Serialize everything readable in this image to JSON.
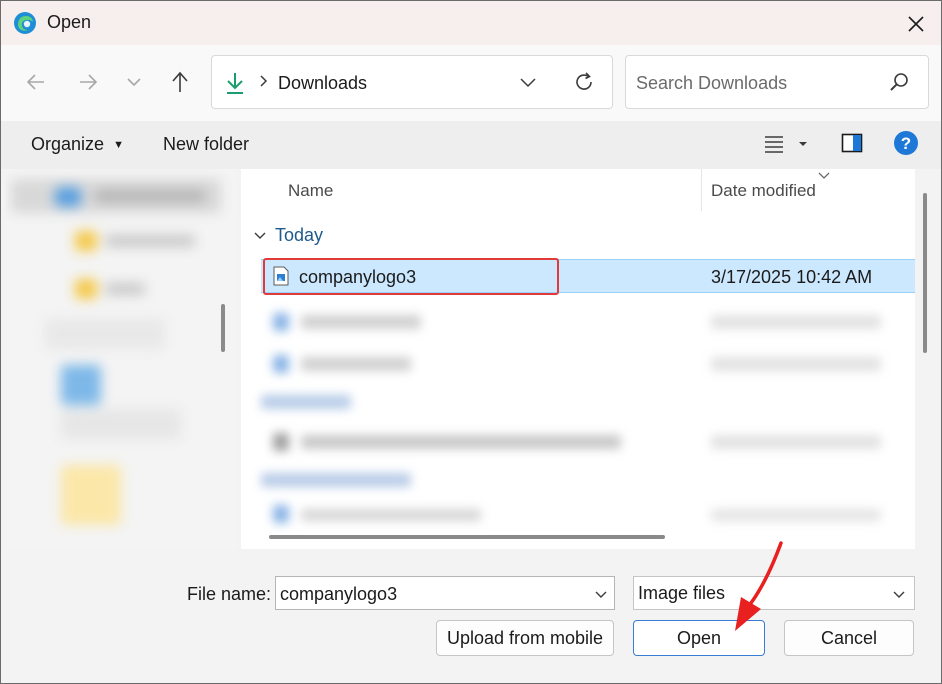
{
  "window": {
    "title": "Open"
  },
  "address": {
    "crumb": "Downloads"
  },
  "search": {
    "placeholder": "Search Downloads"
  },
  "command_bar": {
    "organize": "Organize",
    "new_folder": "New folder"
  },
  "file_list": {
    "columns": {
      "name": "Name",
      "date": "Date modified"
    },
    "group": "Today",
    "selected_file": {
      "name": "companylogo3",
      "date": "3/17/2025 10:42 AM"
    }
  },
  "footer": {
    "file_name_label": "File name:",
    "file_name_value": "companylogo3",
    "file_type": "Image files",
    "upload_button": "Upload from mobile",
    "open_button": "Open",
    "cancel_button": "Cancel"
  },
  "colors": {
    "accent": "#0067c0",
    "selection": "#cce8ff",
    "highlight": "#e03a3a",
    "help": "#1e78d7"
  }
}
